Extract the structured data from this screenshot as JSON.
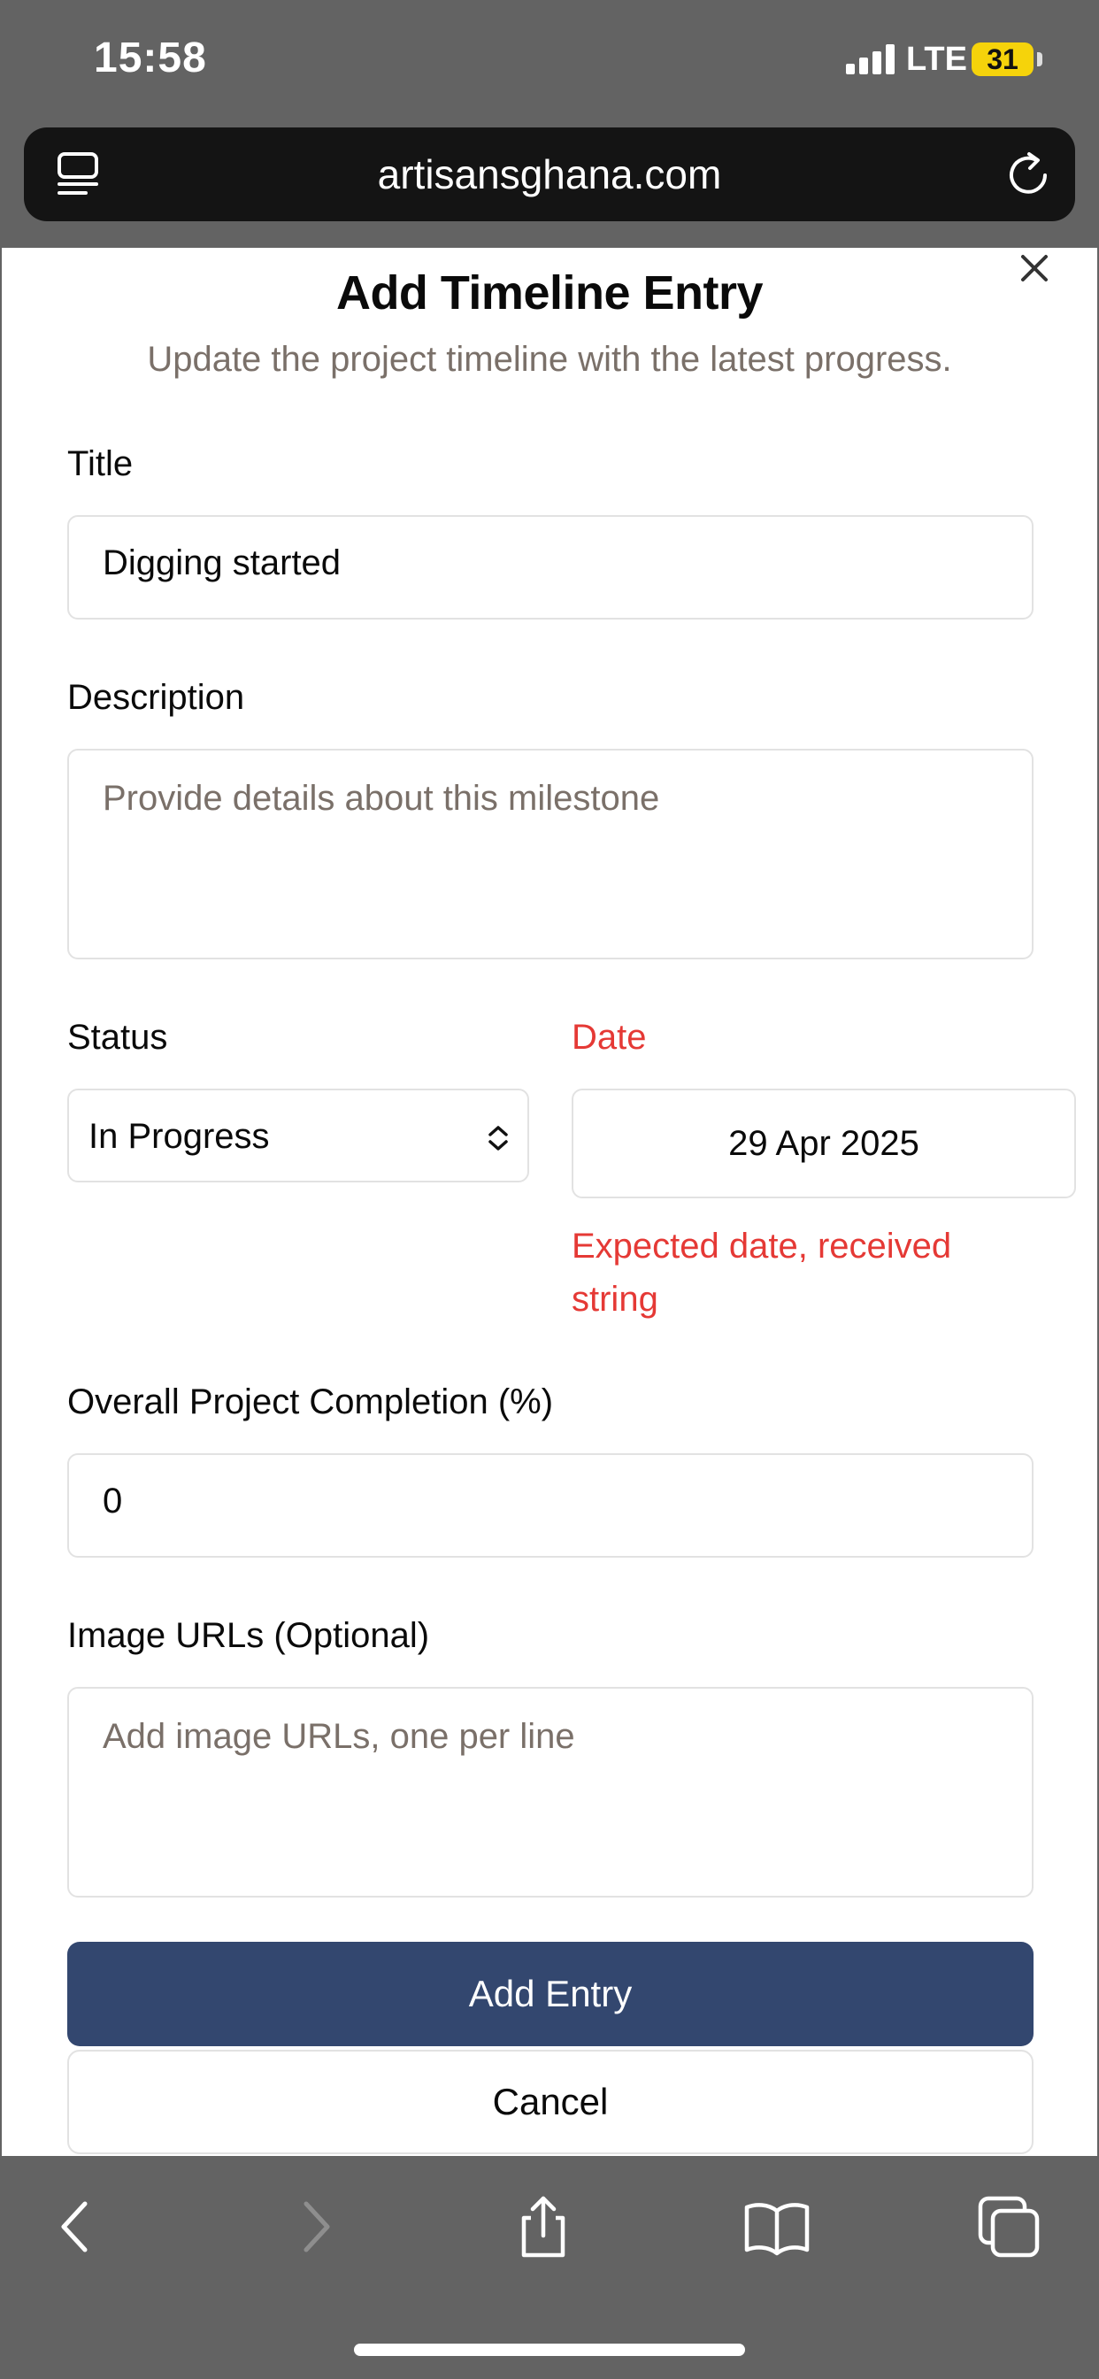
{
  "status_bar": {
    "time": "15:58",
    "network": "LTE",
    "battery": "31"
  },
  "browser": {
    "url": "artisansghana.com"
  },
  "modal": {
    "title": "Add Timeline Entry",
    "subtitle": "Update the project timeline with the latest progress.",
    "fields": {
      "title": {
        "label": "Title",
        "value": "Digging started"
      },
      "description": {
        "label": "Description",
        "placeholder": "Provide details about this milestone"
      },
      "status": {
        "label": "Status",
        "value": "In Progress"
      },
      "date": {
        "label": "Date",
        "value": "29 Apr 2025",
        "error": "Expected date, received string"
      },
      "completion": {
        "label": "Overall Project Completion (%)",
        "value": "0"
      },
      "images": {
        "label": "Image URLs (Optional)",
        "placeholder": "Add image URLs, one per line"
      }
    },
    "buttons": {
      "submit": "Add Entry",
      "cancel": "Cancel"
    }
  },
  "colors": {
    "primary": "#33476f",
    "error": "#e53935",
    "muted_text": "#7a7069",
    "chrome": "#636363"
  },
  "icons": [
    "tabs-icon",
    "reload-icon",
    "close-icon",
    "chevron-updown-icon",
    "back-icon",
    "forward-icon",
    "share-icon",
    "bookmarks-icon",
    "tabs-overview-icon"
  ]
}
